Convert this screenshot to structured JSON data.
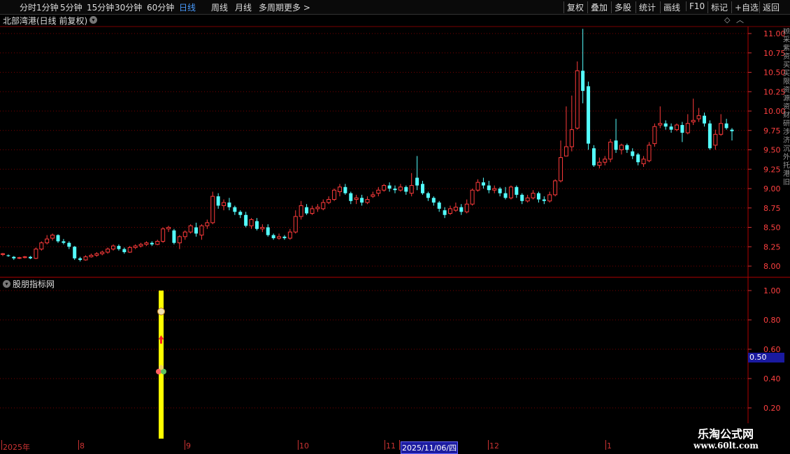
{
  "toolbar": {
    "left": [
      "分时",
      "1分钟",
      "5分钟",
      "15分钟",
      "30分钟",
      "60分钟",
      "日线",
      "周线",
      "月线",
      "多周期",
      "更多 >"
    ],
    "active": "日线",
    "right": [
      "复权",
      "叠加",
      "多股",
      "统计",
      "画线",
      "F10",
      "标记",
      "+自选",
      "返回"
    ]
  },
  "main": {
    "title": "北部湾港(日线 前复权)",
    "price_axis": [
      "11.00",
      "10.75",
      "10.50",
      "10.25",
      "10.00",
      "9.75",
      "9.50",
      "9.25",
      "9.00",
      "8.75",
      "8.50",
      "8.25",
      "8.00"
    ]
  },
  "indicator": {
    "title": "股朋指标网",
    "axis": [
      "1.00",
      "0.80",
      "0.60",
      "0.40",
      "0.20"
    ],
    "current_value": "0.50",
    "signal_value": 1.0
  },
  "date_bar": {
    "labels": [
      "2025年",
      "8",
      "9",
      "10",
      "11",
      "2025/11/06/四",
      "12",
      "1"
    ],
    "selected": "2025/11/06/四"
  },
  "watermark": {
    "line1": "乐淘公式网",
    "line2": "www.60lt.com"
  },
  "side_text": "顾采紫资买买限资源资财研涉济沉外托港旧",
  "colors": {
    "up": "#ff3b3b",
    "down": "#54ffff",
    "grid": "#7a0000",
    "signal": "#ffff00"
  },
  "chart_data": {
    "type": "candlestick",
    "ylim": [
      7.9,
      11.1
    ],
    "candles": [
      [
        8.15,
        8.16,
        8.13,
        8.17
      ],
      [
        8.14,
        8.13,
        8.12,
        8.15
      ],
      [
        8.12,
        8.1,
        8.08,
        8.13
      ],
      [
        8.1,
        8.11,
        8.09,
        8.12
      ],
      [
        8.11,
        8.12,
        8.1,
        8.13
      ],
      [
        8.12,
        8.1,
        8.09,
        8.13
      ],
      [
        8.1,
        8.22,
        8.09,
        8.24
      ],
      [
        8.22,
        8.3,
        8.2,
        8.32
      ],
      [
        8.3,
        8.35,
        8.28,
        8.4
      ],
      [
        8.36,
        8.4,
        8.33,
        8.42
      ],
      [
        8.4,
        8.32,
        8.3,
        8.41
      ],
      [
        8.32,
        8.3,
        8.28,
        8.35
      ],
      [
        8.3,
        8.25,
        8.22,
        8.32
      ],
      [
        8.25,
        8.1,
        8.08,
        8.26
      ],
      [
        8.1,
        8.08,
        8.06,
        8.12
      ],
      [
        8.08,
        8.12,
        8.07,
        8.14
      ],
      [
        8.12,
        8.14,
        8.11,
        8.16
      ],
      [
        8.14,
        8.16,
        8.12,
        8.18
      ],
      [
        8.16,
        8.18,
        8.14,
        8.2
      ],
      [
        8.18,
        8.22,
        8.16,
        8.24
      ],
      [
        8.22,
        8.26,
        8.2,
        8.28
      ],
      [
        8.26,
        8.22,
        8.2,
        8.28
      ],
      [
        8.22,
        8.18,
        8.16,
        8.24
      ],
      [
        8.18,
        8.24,
        8.17,
        8.26
      ],
      [
        8.24,
        8.26,
        8.22,
        8.28
      ],
      [
        8.26,
        8.28,
        8.24,
        8.3
      ],
      [
        8.28,
        8.3,
        8.26,
        8.32
      ],
      [
        8.3,
        8.28,
        8.26,
        8.32
      ],
      [
        8.28,
        8.32,
        8.27,
        8.34
      ],
      [
        8.32,
        8.48,
        8.3,
        8.5
      ],
      [
        8.48,
        8.5,
        8.44,
        8.52
      ],
      [
        8.46,
        8.3,
        8.28,
        8.48
      ],
      [
        8.3,
        8.38,
        8.22,
        8.4
      ],
      [
        8.38,
        8.44,
        8.34,
        8.46
      ],
      [
        8.44,
        8.52,
        8.42,
        8.54
      ],
      [
        8.5,
        8.42,
        8.38,
        8.56
      ],
      [
        8.4,
        8.52,
        8.34,
        8.54
      ],
      [
        8.52,
        8.56,
        8.48,
        8.6
      ],
      [
        8.56,
        8.9,
        8.54,
        8.96
      ],
      [
        8.9,
        8.78,
        8.74,
        8.94
      ],
      [
        8.78,
        8.82,
        8.72,
        8.86
      ],
      [
        8.82,
        8.76,
        8.72,
        8.88
      ],
      [
        8.76,
        8.7,
        8.66,
        8.78
      ],
      [
        8.7,
        8.66,
        8.62,
        8.72
      ],
      [
        8.66,
        8.52,
        8.5,
        8.7
      ],
      [
        8.52,
        8.6,
        8.48,
        8.62
      ],
      [
        8.58,
        8.48,
        8.46,
        8.62
      ],
      [
        8.48,
        8.5,
        8.44,
        8.54
      ],
      [
        8.5,
        8.4,
        8.38,
        8.54
      ],
      [
        8.4,
        8.36,
        8.34,
        8.42
      ],
      [
        8.36,
        8.38,
        8.34,
        8.42
      ],
      [
        8.38,
        8.36,
        8.34,
        8.4
      ],
      [
        8.36,
        8.44,
        8.34,
        8.48
      ],
      [
        8.44,
        8.64,
        8.42,
        8.72
      ],
      [
        8.64,
        8.78,
        8.6,
        8.84
      ],
      [
        8.76,
        8.68,
        8.66,
        8.8
      ],
      [
        8.68,
        8.74,
        8.66,
        8.78
      ],
      [
        8.74,
        8.76,
        8.7,
        8.8
      ],
      [
        8.74,
        8.82,
        8.72,
        8.86
      ],
      [
        8.82,
        8.86,
        8.8,
        8.9
      ],
      [
        8.86,
        8.98,
        8.84,
        9.0
      ],
      [
        8.96,
        9.02,
        8.9,
        9.06
      ],
      [
        9.02,
        8.94,
        8.92,
        9.06
      ],
      [
        8.94,
        8.84,
        8.8,
        8.96
      ],
      [
        8.86,
        8.88,
        8.8,
        8.92
      ],
      [
        8.88,
        8.82,
        8.78,
        8.92
      ],
      [
        8.82,
        8.86,
        8.8,
        8.9
      ],
      [
        8.9,
        8.92,
        8.88,
        8.96
      ],
      [
        8.94,
        8.98,
        8.9,
        9.02
      ],
      [
        8.98,
        9.04,
        8.96,
        9.06
      ],
      [
        9.04,
        9.0,
        8.96,
        9.08
      ],
      [
        9.0,
        8.98,
        8.94,
        9.04
      ],
      [
        8.98,
        9.02,
        8.96,
        9.06
      ],
      [
        9.02,
        8.96,
        8.92,
        9.04
      ],
      [
        8.94,
        9.04,
        8.9,
        9.2
      ],
      [
        9.14,
        9.04,
        8.98,
        9.42
      ],
      [
        9.06,
        8.94,
        8.92,
        9.1
      ],
      [
        8.94,
        8.88,
        8.84,
        8.96
      ],
      [
        8.88,
        8.82,
        8.78,
        8.9
      ],
      [
        8.82,
        8.74,
        8.7,
        8.84
      ],
      [
        8.72,
        8.66,
        8.62,
        8.76
      ],
      [
        8.68,
        8.74,
        8.66,
        8.78
      ],
      [
        8.72,
        8.76,
        8.7,
        8.82
      ],
      [
        8.76,
        8.7,
        8.66,
        8.8
      ],
      [
        8.7,
        8.8,
        8.68,
        8.86
      ],
      [
        8.8,
        8.98,
        8.78,
        9.0
      ],
      [
        8.98,
        9.08,
        8.96,
        9.12
      ],
      [
        9.08,
        9.04,
        9.0,
        9.14
      ],
      [
        9.04,
        8.98,
        8.94,
        9.1
      ],
      [
        8.98,
        9.0,
        8.94,
        9.04
      ],
      [
        9.0,
        8.94,
        8.9,
        9.02
      ],
      [
        8.94,
        8.88,
        8.86,
        9.02
      ],
      [
        8.88,
        9.02,
        8.86,
        9.04
      ],
      [
        9.02,
        8.92,
        8.88,
        9.04
      ],
      [
        8.92,
        8.84,
        8.8,
        8.94
      ],
      [
        8.84,
        8.88,
        8.82,
        8.92
      ],
      [
        8.88,
        8.94,
        8.86,
        8.98
      ],
      [
        8.94,
        8.86,
        8.82,
        8.96
      ],
      [
        8.86,
        8.84,
        8.8,
        8.9
      ],
      [
        8.84,
        8.92,
        8.82,
        8.96
      ],
      [
        8.92,
        9.1,
        8.9,
        9.12
      ],
      [
        9.1,
        9.4,
        9.08,
        9.62
      ],
      [
        9.42,
        9.54,
        9.46,
        10.06
      ],
      [
        9.54,
        9.76,
        9.48,
        10.2
      ],
      [
        9.78,
        10.52,
        9.76,
        10.64
      ],
      [
        10.52,
        10.26,
        10.1,
        11.06
      ],
      [
        10.32,
        9.58,
        9.5,
        10.38
      ],
      [
        9.52,
        9.3,
        9.28,
        9.56
      ],
      [
        9.3,
        9.34,
        9.26,
        9.4
      ],
      [
        9.34,
        9.38,
        9.3,
        9.42
      ],
      [
        9.38,
        9.6,
        9.34,
        9.64
      ],
      [
        9.62,
        9.5,
        9.46,
        9.9
      ],
      [
        9.5,
        9.56,
        9.44,
        9.58
      ],
      [
        9.56,
        9.5,
        9.46,
        9.58
      ],
      [
        9.48,
        9.42,
        9.38,
        9.52
      ],
      [
        9.44,
        9.34,
        9.3,
        9.46
      ],
      [
        9.32,
        9.38,
        9.28,
        9.42
      ],
      [
        9.36,
        9.56,
        9.34,
        9.6
      ],
      [
        9.58,
        9.8,
        9.54,
        9.84
      ],
      [
        9.82,
        9.84,
        9.78,
        10.06
      ],
      [
        9.84,
        9.8,
        9.76,
        9.88
      ],
      [
        9.8,
        9.76,
        9.72,
        9.84
      ],
      [
        9.76,
        9.82,
        9.74,
        9.84
      ],
      [
        9.82,
        9.72,
        9.6,
        9.86
      ],
      [
        9.72,
        9.84,
        9.7,
        9.96
      ],
      [
        9.86,
        9.88,
        9.82,
        10.16
      ],
      [
        9.9,
        9.94,
        9.86,
        10.04
      ],
      [
        9.94,
        9.84,
        9.8,
        9.98
      ],
      [
        9.84,
        9.52,
        9.5,
        9.88
      ],
      [
        9.56,
        9.7,
        9.5,
        9.76
      ],
      [
        9.7,
        9.84,
        9.68,
        9.96
      ],
      [
        9.84,
        9.78,
        9.76,
        9.9
      ],
      [
        9.76,
        9.74,
        9.62,
        9.78
      ]
    ]
  }
}
